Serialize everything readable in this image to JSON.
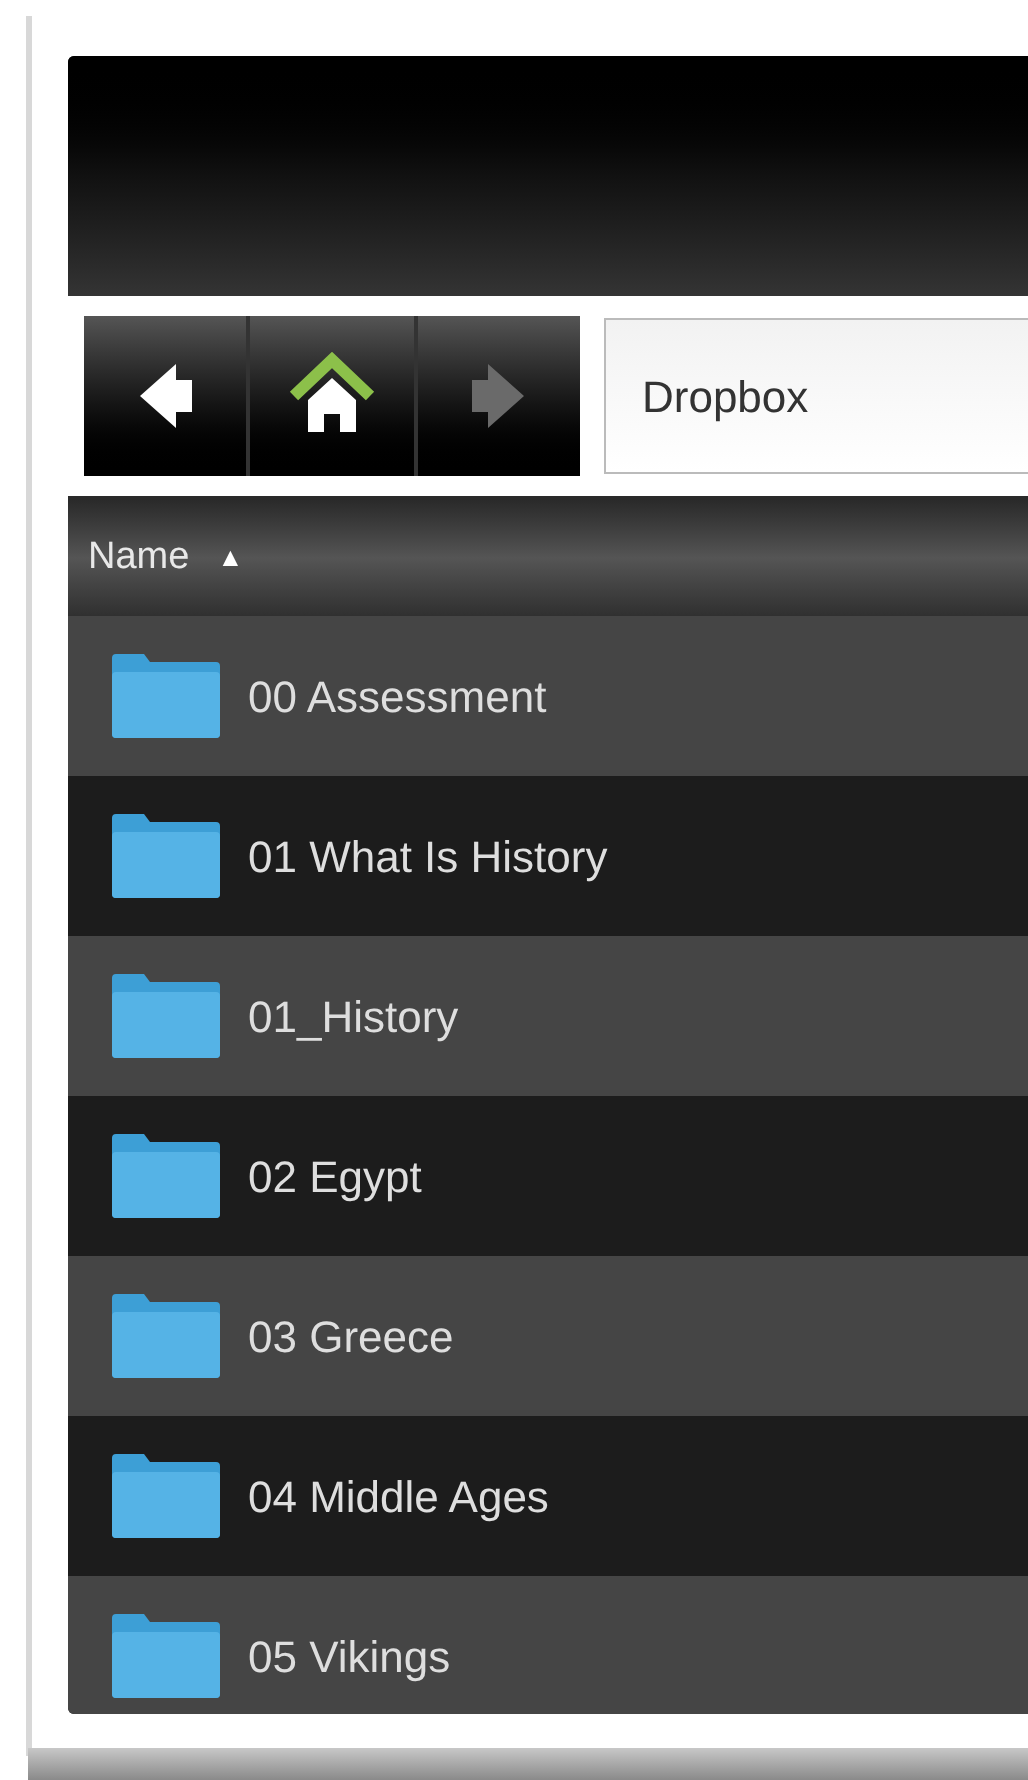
{
  "toolbar": {
    "buttons": [
      {
        "kind": "back",
        "disabled": false
      },
      {
        "kind": "home",
        "disabled": false
      },
      {
        "kind": "forward",
        "disabled": true
      }
    ],
    "path": "Dropbox"
  },
  "column_header": {
    "label": "Name",
    "sort_indicator": "▲"
  },
  "rows": [
    {
      "name": "00 Assessment"
    },
    {
      "name": "01 What Is History"
    },
    {
      "name": "01_History"
    },
    {
      "name": "02 Egypt"
    },
    {
      "name": "03 Greece"
    },
    {
      "name": "04 Middle Ages"
    },
    {
      "name": "05 Vikings"
    }
  ]
}
